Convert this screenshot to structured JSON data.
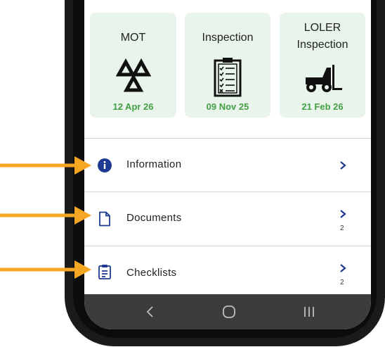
{
  "cards": [
    {
      "title": "MOT",
      "date": "12 Apr 26",
      "icon": "triangle-stack-icon"
    },
    {
      "title": "Inspection",
      "date": "09 Nov 25",
      "icon": "clipboard-checklist-icon"
    },
    {
      "title": "LOLER Inspection",
      "date": "21 Feb 26",
      "icon": "forklift-icon"
    }
  ],
  "menu": [
    {
      "label": "Information",
      "icon": "info-icon",
      "count": ""
    },
    {
      "label": "Documents",
      "icon": "document-icon",
      "count": "2"
    },
    {
      "label": "Checklists",
      "icon": "checklist-icon",
      "count": "2"
    }
  ],
  "colors": {
    "accent_blue": "#1f3a93",
    "date_green": "#43a047",
    "card_bg": "#e9f5ea",
    "arrow_orange": "#f5a623",
    "navbar": "#3c3c3c"
  },
  "navbar": {
    "buttons": [
      "back-icon",
      "home-icon",
      "recents-icon"
    ]
  }
}
